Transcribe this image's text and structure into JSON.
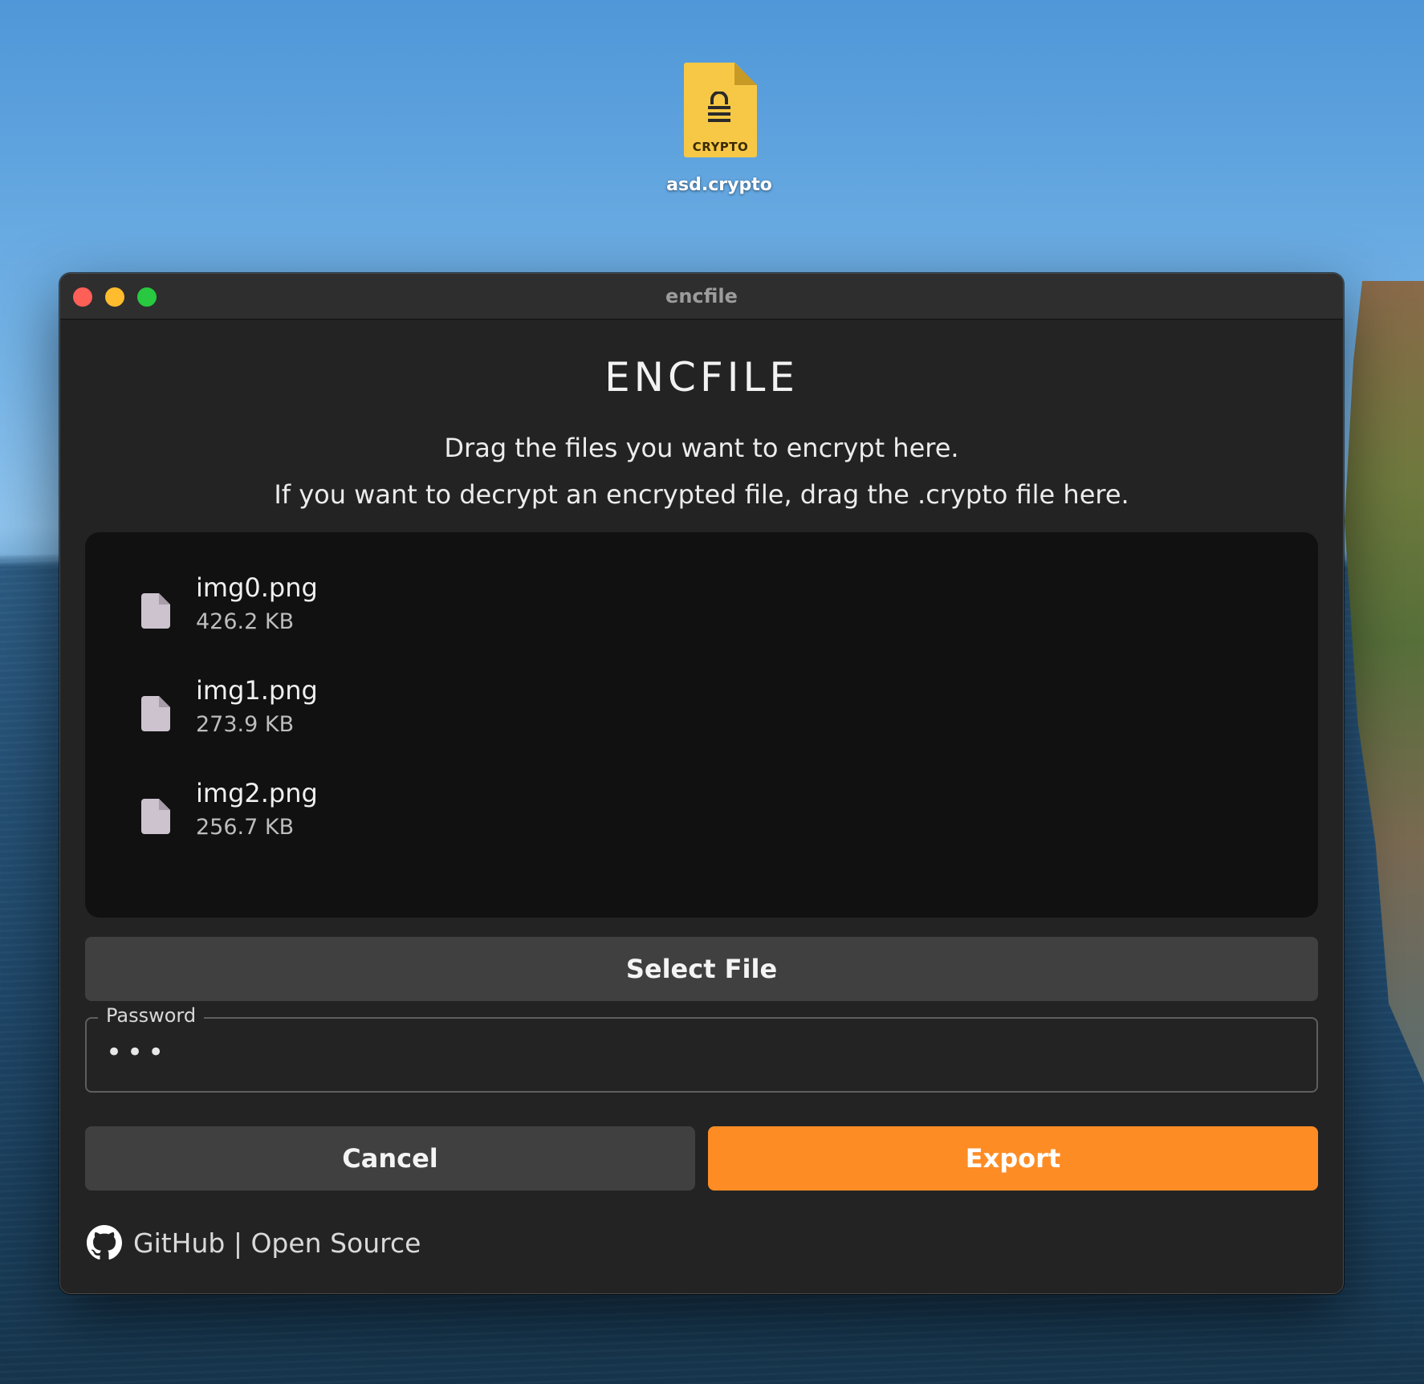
{
  "desktop": {
    "icon": {
      "name": "asd.crypto",
      "badge": "CRYPTO",
      "icon": "locked-document-icon",
      "color": "#f7c846"
    }
  },
  "window": {
    "title": "encfile",
    "controls": [
      "close",
      "minimize",
      "zoom"
    ]
  },
  "app": {
    "heading": "ENCFILE",
    "instructions": [
      "Drag the files you want to encrypt here.",
      "If you want to decrypt an encrypted file, drag the .crypto file here."
    ],
    "files": [
      {
        "name": "img0.png",
        "size": "426.2 KB",
        "icon": "file-icon"
      },
      {
        "name": "img1.png",
        "size": "273.9 KB",
        "icon": "file-icon"
      },
      {
        "name": "img2.png",
        "size": "256.7 KB",
        "icon": "file-icon"
      }
    ],
    "select_button": "Select File",
    "password": {
      "label": "Password",
      "value": "•••"
    },
    "cancel_button": "Cancel",
    "export_button": "Export",
    "accent_color": "#fe8c25",
    "footer_link": {
      "text": "GitHub | Open Source",
      "icon": "github-icon"
    }
  }
}
